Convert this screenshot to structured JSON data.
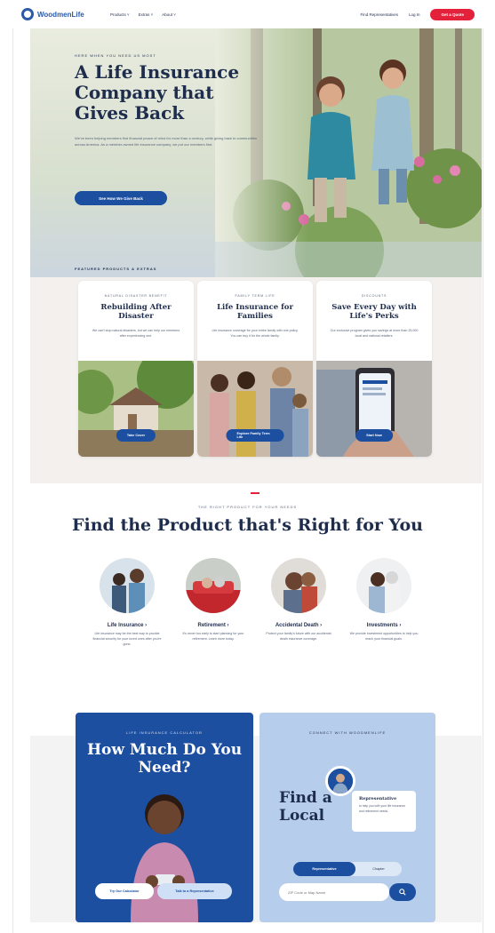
{
  "header": {
    "logo_text": "WoodmenLife",
    "nav": [
      "Products ˅",
      "Extras ˅",
      "About ˅"
    ],
    "find_rep": "Find Representatives",
    "login": "Log In",
    "quote": "Get a Quote",
    "accent_color": "#e3213a"
  },
  "hero": {
    "eyebrow": "HERE WHEN YOU NEED US MOST",
    "title": "A Life Insurance Company that Gives Back",
    "body": "We've been helping members find financial peace of mind for more than a century, while giving back to communities across America. As a member-owned life insurance company, we put our members first.",
    "cta": "See How We Give Back",
    "featured_label": "FEATURED PRODUCTS & EXTRAS"
  },
  "cards": [
    {
      "eyebrow": "NATURAL DISASTER BENEFIT",
      "title": "Rebuilding After Disaster",
      "desc": "We can't stop natural disasters, but we can help our members after experiencing one.",
      "button": "Take Cover"
    },
    {
      "eyebrow": "FAMILY TERM LIFE",
      "title": "Life Insurance for Families",
      "desc": "Life insurance coverage for your entire family with one policy. You can buy it for the whole family.",
      "button": "Explore Family Term Life"
    },
    {
      "eyebrow": "DISCOUNTS",
      "title": "Save Every Day with Life's Perks",
      "desc": "Our exclusive program gives you savings at more than 25,000 local and national retailers.",
      "button": "Start Now"
    }
  ],
  "products": {
    "eyebrow": "THE RIGHT PRODUCT FOR YOUR NEEDS",
    "title": "Find the Product that's Right for You",
    "items": [
      {
        "name": "Life Insurance ›",
        "desc": "Life insurance may be the best way to provide financial security for your loved ones after you're gone."
      },
      {
        "name": "Retirement ›",
        "desc": "It's never too early to start planning for your retirement. Learn more today."
      },
      {
        "name": "Accidental Death ›",
        "desc": "Protect your family's future with our accidental death insurance coverage."
      },
      {
        "name": "Investments ›",
        "desc": "We provide investment opportunities to help you reach your financial goals."
      }
    ]
  },
  "calculator": {
    "eyebrow": "LIFE INSURANCE CALCULATOR",
    "title": "How Much Do You Need?",
    "btn_calc": "Try Our Calculator",
    "btn_rep": "Talk to a Representative"
  },
  "connect": {
    "eyebrow": "CONNECT WITH WOODMENLIFE",
    "title": "Find a Local",
    "rep_title": "Representative",
    "rep_desc": "to help you with your life insurance and retirement needs.",
    "toggle_on": "Representative",
    "toggle_off": "Chapter",
    "zip_placeholder": "ZIP Code or Map Name"
  }
}
